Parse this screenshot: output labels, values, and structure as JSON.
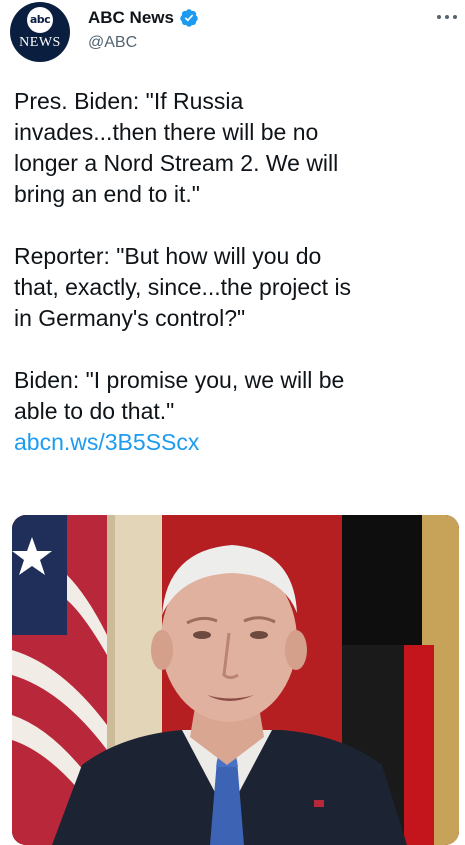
{
  "author": {
    "display_name": "ABC News",
    "handle": "@ABC",
    "avatar_logo_top": "abc",
    "avatar_logo_bottom": "NEWS",
    "verified": true
  },
  "tweet": {
    "paragraphs": [
      "Pres. Biden: \"If Russia\ninvades...then there will be no\nlonger a Nord Stream 2. We will\nbring an end to it.\"",
      "Reporter: \"But how will you do\nthat, exactly, since...the project is\nin Germany's control?\"",
      "Biden: \"I promise you, we will be\nable to do that.\""
    ],
    "link": "abcn.ws/3B5SScx"
  },
  "media": {
    "type": "photo"
  },
  "colors": {
    "link": "#1d9bf0",
    "verified": "#1d9bf0",
    "secondary_text": "#536471",
    "abc_navy": "#0a1f3f"
  },
  "icons": [
    "verified-badge-icon",
    "more-options-icon"
  ]
}
